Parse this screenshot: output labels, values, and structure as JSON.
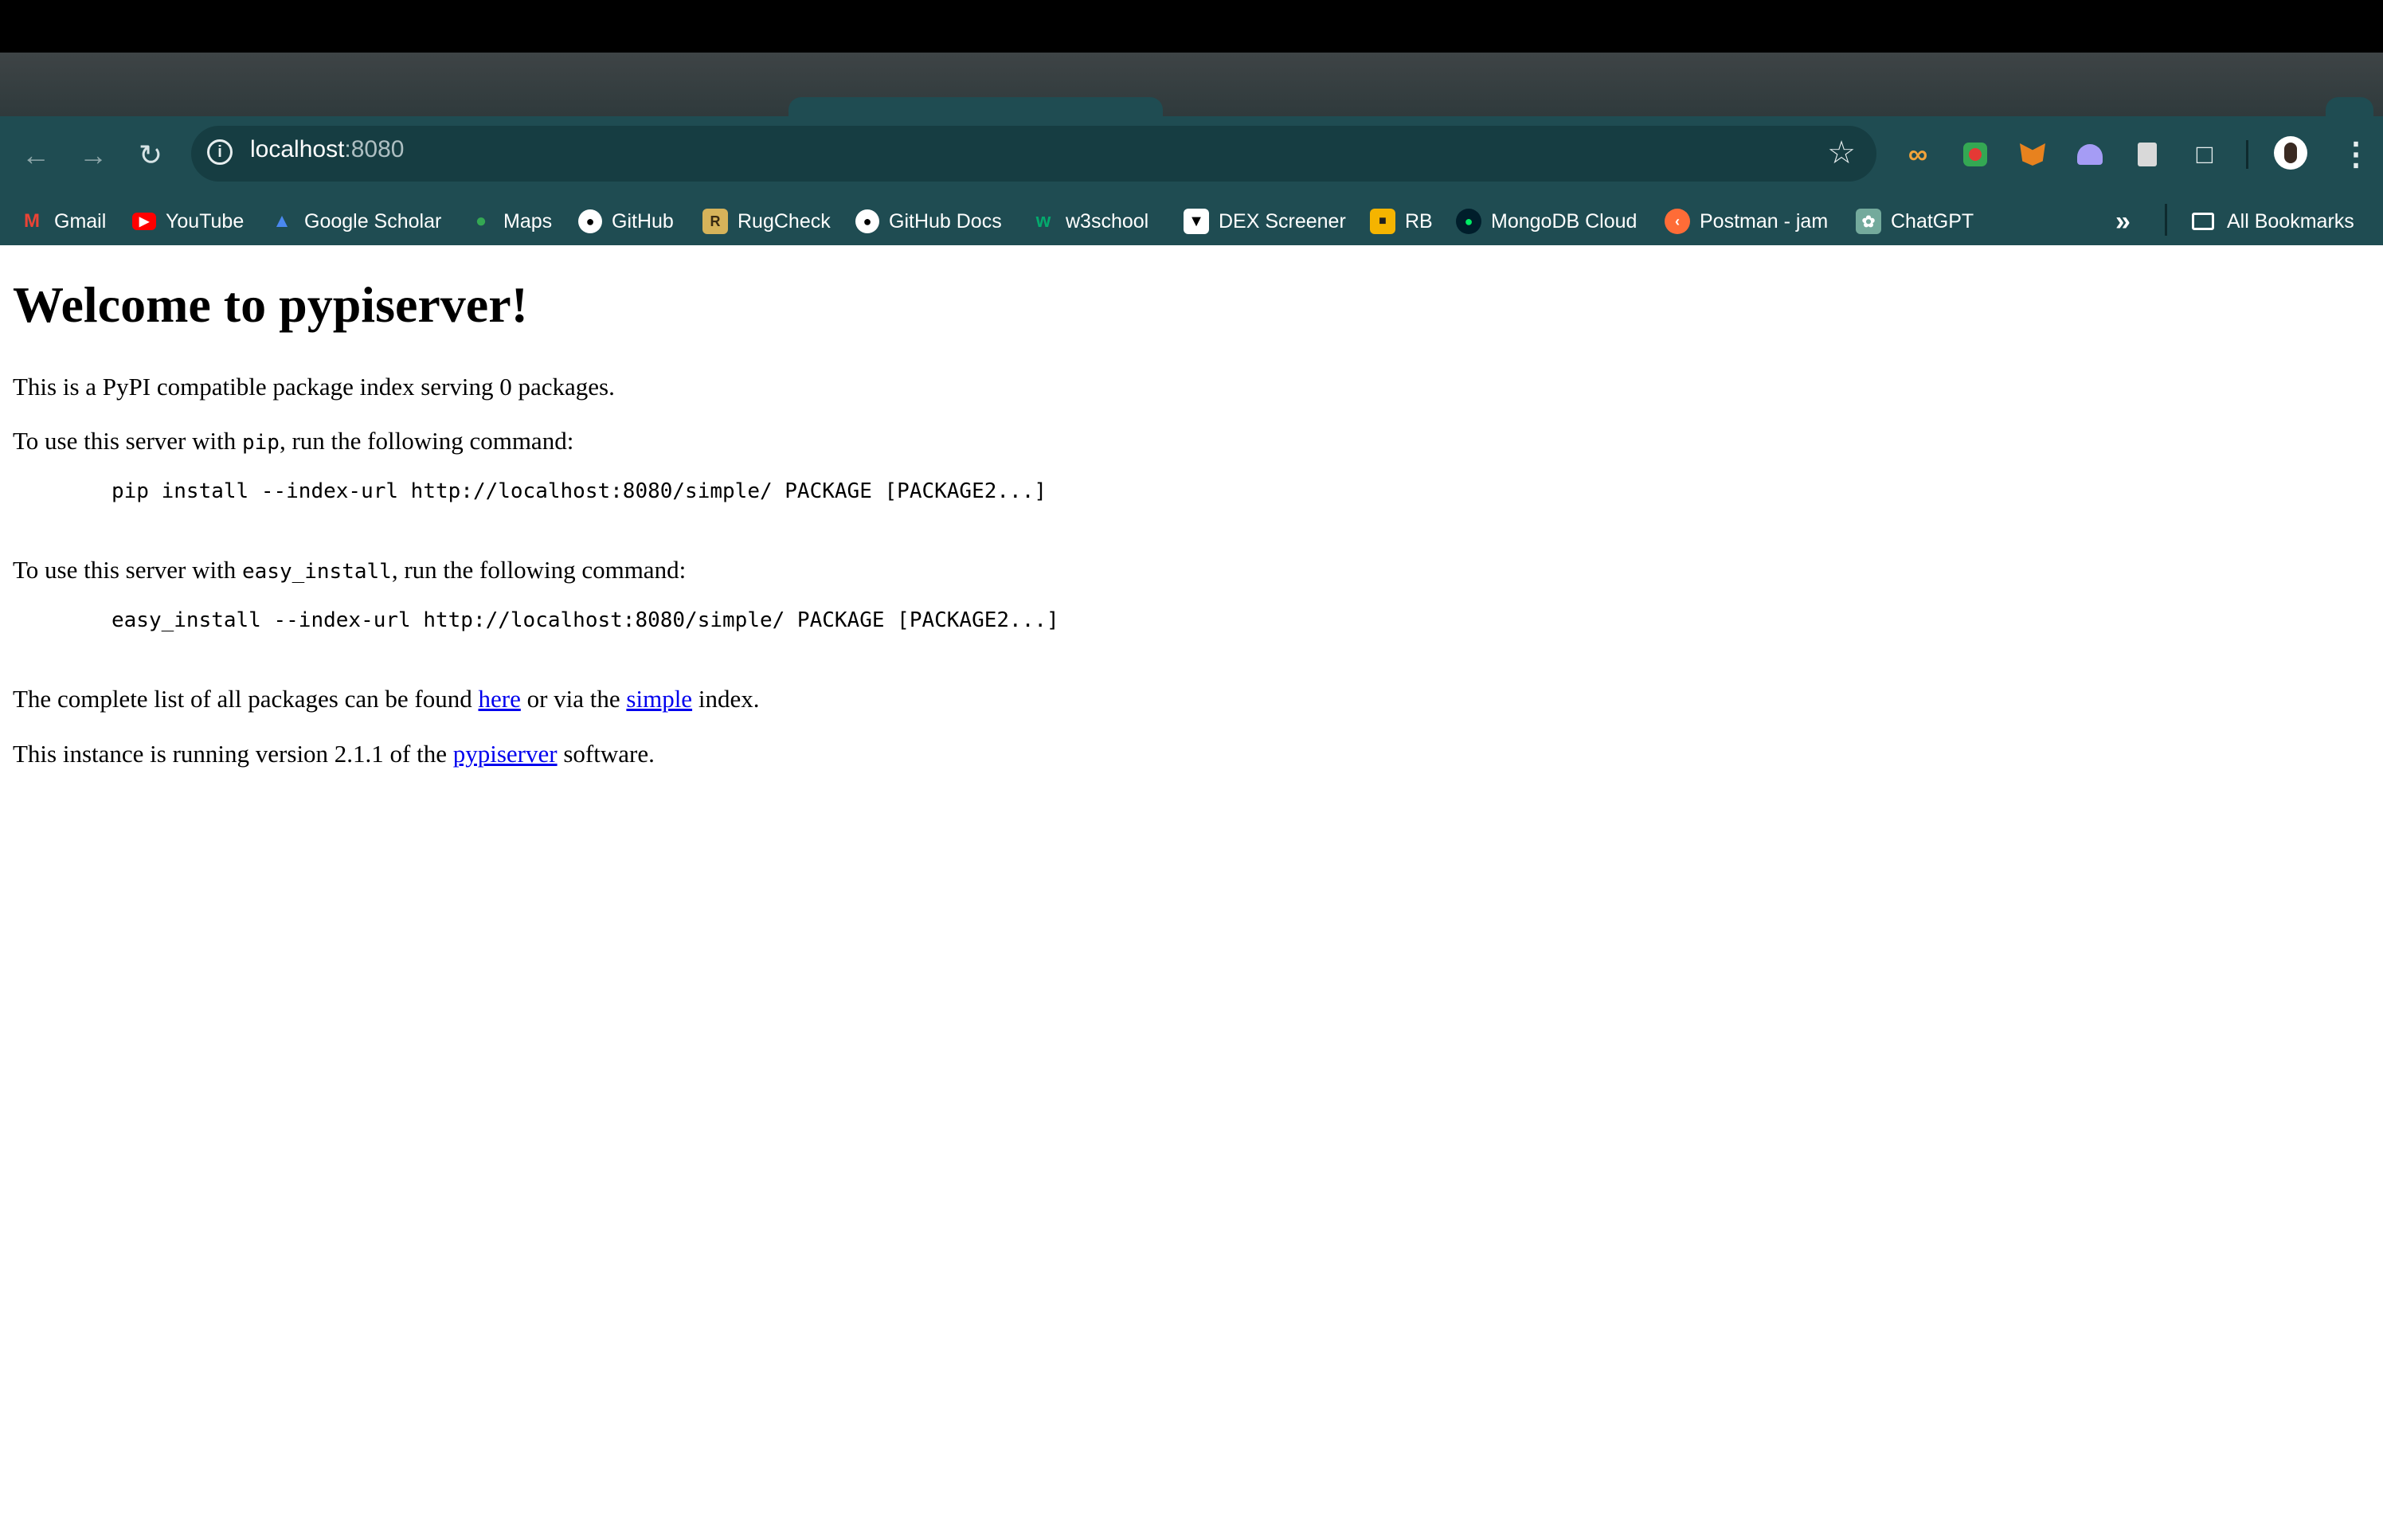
{
  "browser": {
    "address": {
      "host": "localhost",
      "port": ":8080"
    },
    "bookmarks": [
      {
        "label": "Gmail",
        "icon": "gmail-icon"
      },
      {
        "label": "YouTube",
        "icon": "youtube-icon"
      },
      {
        "label": "Google Scholar",
        "icon": "google-scholar-icon"
      },
      {
        "label": "Maps",
        "icon": "maps-icon"
      },
      {
        "label": "GitHub",
        "icon": "github-icon"
      },
      {
        "label": "RugCheck",
        "icon": "rugcheck-icon"
      },
      {
        "label": "GitHub Docs",
        "icon": "github-icon"
      },
      {
        "label": "w3school",
        "icon": "w3school-icon"
      },
      {
        "label": "DEX Screener",
        "icon": "dex-screener-icon"
      },
      {
        "label": "RB",
        "icon": "rb-icon"
      },
      {
        "label": "MongoDB Cloud",
        "icon": "mongodb-icon"
      },
      {
        "label": "Postman - jam",
        "icon": "postman-icon"
      },
      {
        "label": "ChatGPT",
        "icon": "chatgpt-icon"
      }
    ],
    "all_bookmarks": "All Bookmarks"
  },
  "page": {
    "title": "Welcome to pypiserver!",
    "intro": "This is a PyPI compatible package index serving 0 packages.",
    "pip": {
      "before": "To use this server with ",
      "code": "pip",
      "after": ", run the following command:",
      "command": "pip install --index-url http://localhost:8080/simple/ PACKAGE [PACKAGE2...]"
    },
    "easy": {
      "before": "To use this server with ",
      "code": "easy_install",
      "after": ", run the following command:",
      "command": "easy_install --index-url http://localhost:8080/simple/ PACKAGE [PACKAGE2...]"
    },
    "list": {
      "before": "The complete list of all packages can be found ",
      "link1": "here",
      "middle": " or via the ",
      "link2": "simple",
      "after": " index."
    },
    "version": {
      "before": "This instance is running version 2.1.1 of the ",
      "link": "pypiserver",
      "after": " software."
    }
  }
}
